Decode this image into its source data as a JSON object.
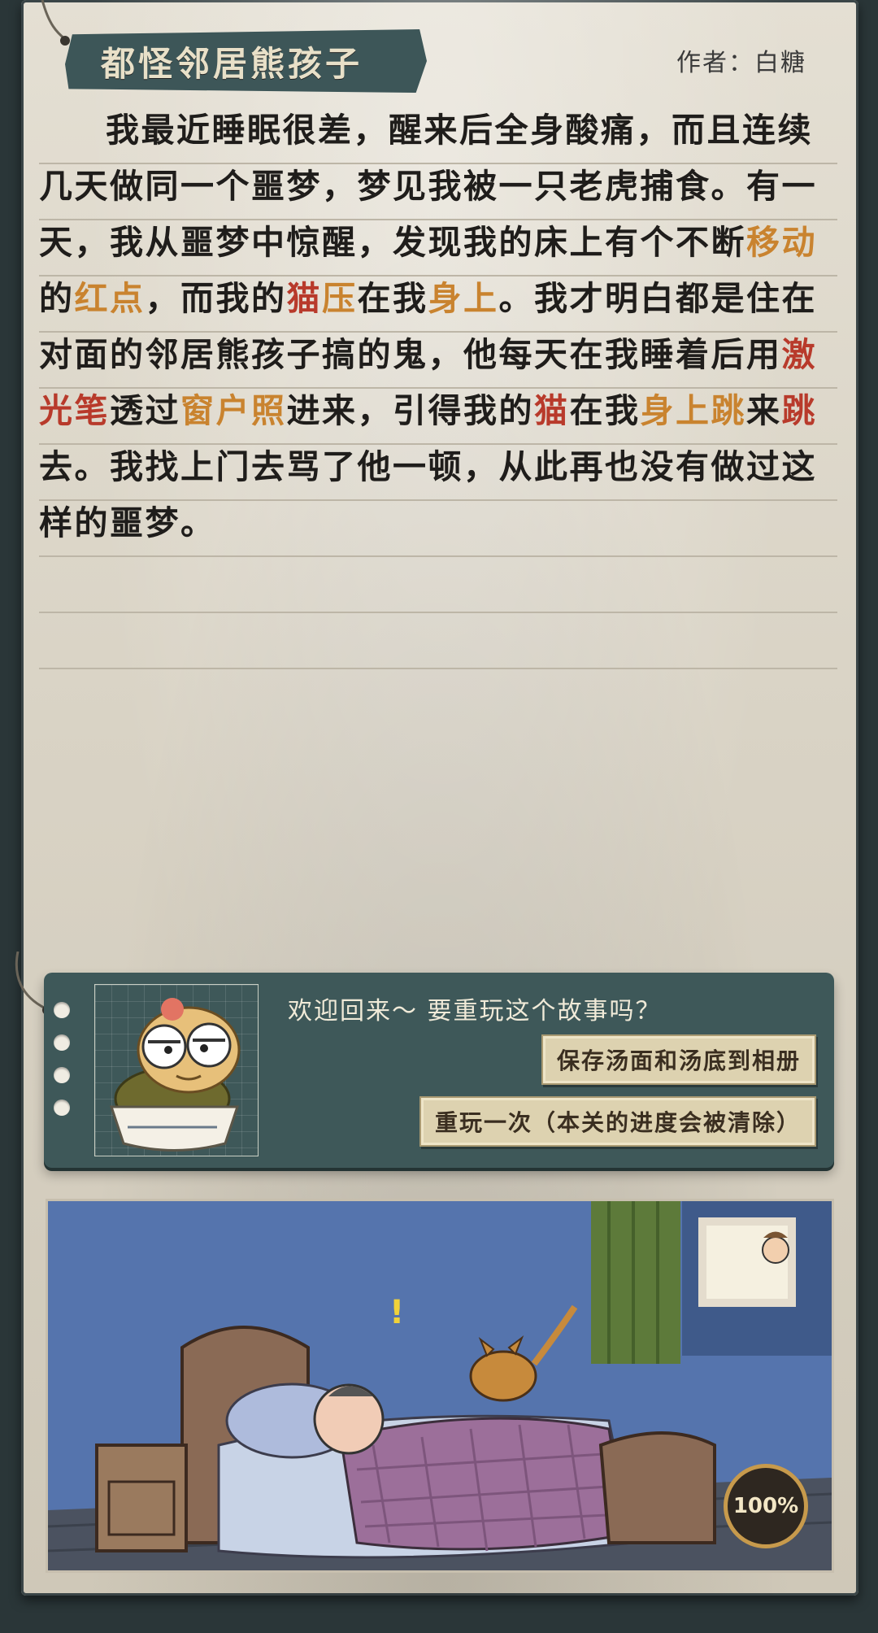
{
  "header": {
    "title": "都怪邻居熊孩子",
    "author": "作者：白糖"
  },
  "story": {
    "segments": [
      {
        "t": "我最近睡眠很差，醒来后全身酸痛，而且连续几天做同一个噩梦，梦见我被一只老虎捕食。有一天，我从噩梦中惊醒，发现我的床上有个不断"
      },
      {
        "t": "移动",
        "c": "orange"
      },
      {
        "t": "的"
      },
      {
        "t": "红点",
        "c": "orange"
      },
      {
        "t": "，而我的"
      },
      {
        "t": "猫",
        "c": "red"
      },
      {
        "t": "压",
        "c": "orange"
      },
      {
        "t": "在我"
      },
      {
        "t": "身上",
        "c": "orange"
      },
      {
        "t": "。我才明白都是住在对面的邻居熊孩子搞的鬼，他每天在我睡着后用"
      },
      {
        "t": "激光笔",
        "c": "red"
      },
      {
        "t": "透过"
      },
      {
        "t": "窗户照",
        "c": "orange"
      },
      {
        "t": "进来，引得我的"
      },
      {
        "t": "猫",
        "c": "red"
      },
      {
        "t": "在我"
      },
      {
        "t": "身上跳",
        "c": "orange"
      },
      {
        "t": "来"
      },
      {
        "t": "跳",
        "c": "red"
      },
      {
        "t": "去。我找上门去骂了他一顿，从此再也没有做过这样的噩梦。"
      }
    ]
  },
  "dialog": {
    "prompt": "欢迎回来～ 要重玩这个故事吗？",
    "save_label": "保存汤面和汤底到相册",
    "replay_label": "重玩一次（本关的进度会被清除）"
  },
  "illustration": {
    "progress_label": "100%",
    "progress": 1.0
  },
  "colors": {
    "highlight_red": "#b83a2b",
    "highlight_orange": "#c9832f",
    "panel": "#3e5859"
  }
}
